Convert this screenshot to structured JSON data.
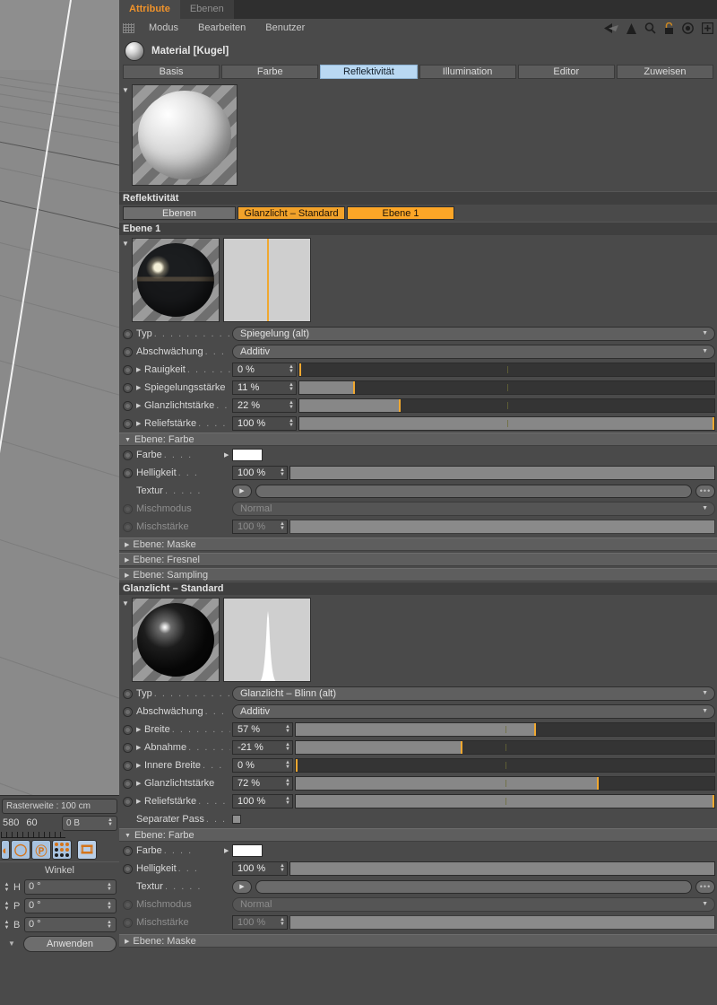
{
  "viewport": {
    "raster_label": "Rasterweite : 100 cm",
    "frame_start": "580",
    "frame_end": "60",
    "memory": "0 B",
    "angle_header": "Winkel",
    "angle_rows": [
      {
        "label": "H",
        "value": "0 °"
      },
      {
        "label": "P",
        "value": "0 °"
      },
      {
        "label": "B",
        "value": "0 °"
      }
    ],
    "apply_button": "Anwenden"
  },
  "window": {
    "tabs": [
      {
        "label": "Attribute",
        "active": true
      },
      {
        "label": "Ebenen",
        "active": false
      }
    ],
    "menu": [
      "Modus",
      "Bearbeiten",
      "Benutzer"
    ],
    "icons": [
      "back-arrow-icon",
      "forward-arrow-icon",
      "up-arrow-icon",
      "search-icon",
      "lock-icon",
      "target-icon",
      "plus-box-icon"
    ]
  },
  "material": {
    "title": "Material [Kugel]",
    "page_tabs": [
      {
        "label": "Basis",
        "selected": false
      },
      {
        "label": "Farbe",
        "selected": false
      },
      {
        "label": "Reflektivität",
        "selected": true
      },
      {
        "label": "Illumination",
        "selected": false
      },
      {
        "label": "Editor",
        "selected": false
      },
      {
        "label": "Zuweisen",
        "selected": false
      }
    ]
  },
  "reflectivity": {
    "header": "Reflektivität",
    "layer_tabs": [
      {
        "label": "Ebenen",
        "style": "gray"
      },
      {
        "label": "Glanzlicht – Standard",
        "style": "orange"
      },
      {
        "label": "Ebene 1",
        "style": "orange2"
      }
    ]
  },
  "ebene1": {
    "header": "Ebene 1",
    "typ": {
      "label": "Typ",
      "value": "Spiegelung (alt)"
    },
    "abschwaechung": {
      "label": "Abschwächung",
      "value": "Additiv"
    },
    "sliders": [
      {
        "label": "Rauigkeit",
        "value": "0 %",
        "fill": 0,
        "knob": 0
      },
      {
        "label": "Spiegelungsstärke",
        "value": "11 %",
        "fill": 13,
        "knob": 13
      },
      {
        "label": "Glanzlichtstärke",
        "value": "22 %",
        "fill": 24,
        "knob": 24
      },
      {
        "label": "Reliefstärke",
        "value": "100 %",
        "fill": 100,
        "knob": 99.6
      }
    ],
    "farbe_group": {
      "header": "Ebene: Farbe",
      "farbe": {
        "label": "Farbe",
        "color": "#ffffff"
      },
      "helligkeit": {
        "label": "Helligkeit",
        "value": "100 %",
        "fill": 100
      },
      "textur": {
        "label": "Textur",
        "value": ""
      },
      "mischmodus": {
        "label": "Mischmodus",
        "value": "Normal",
        "disabled": true
      },
      "mischstaerke": {
        "label": "Mischstärke",
        "value": "100 %",
        "disabled": true
      }
    },
    "collapsed": [
      "Ebene: Maske",
      "Ebene: Fresnel",
      "Ebene: Sampling"
    ]
  },
  "glanzlicht": {
    "header": "Glanzlicht – Standard",
    "typ": {
      "label": "Typ",
      "value": "Glanzlicht – Blinn (alt)"
    },
    "abschwaechung": {
      "label": "Abschwächung",
      "value": "Additiv"
    },
    "sliders": [
      {
        "label": "Breite",
        "value": "57 %",
        "fill": 57,
        "knob": 57
      },
      {
        "label": "Abnahme",
        "value": "-21 %",
        "fill": 39.5,
        "knob": 39.5
      },
      {
        "label": "Innere Breite",
        "value": "0 %",
        "fill": 0,
        "knob": 0
      },
      {
        "label": "Glanzlichtstärke",
        "value": "72 %",
        "fill": 72,
        "knob": 72
      },
      {
        "label": "Reliefstärke",
        "value": "100 %",
        "fill": 100,
        "knob": 99.6
      }
    ],
    "separater_pass": {
      "label": "Separater Pass",
      "checked": false
    },
    "farbe_group": {
      "header": "Ebene: Farbe",
      "farbe": {
        "label": "Farbe",
        "color": "#ffffff"
      },
      "helligkeit": {
        "label": "Helligkeit",
        "value": "100 %",
        "fill": 100
      },
      "textur": {
        "label": "Textur",
        "value": ""
      },
      "mischmodus": {
        "label": "Mischmodus",
        "value": "Normal",
        "disabled": true
      },
      "mischstaerke": {
        "label": "Mischstärke",
        "value": "100 %",
        "disabled": true
      }
    },
    "collapsed": [
      "Ebene: Maske"
    ]
  },
  "colors": {
    "accent_orange": "#f0a830",
    "tab_selected_blue": "#b9d8f2",
    "panel_bg": "#4a4a4a"
  }
}
